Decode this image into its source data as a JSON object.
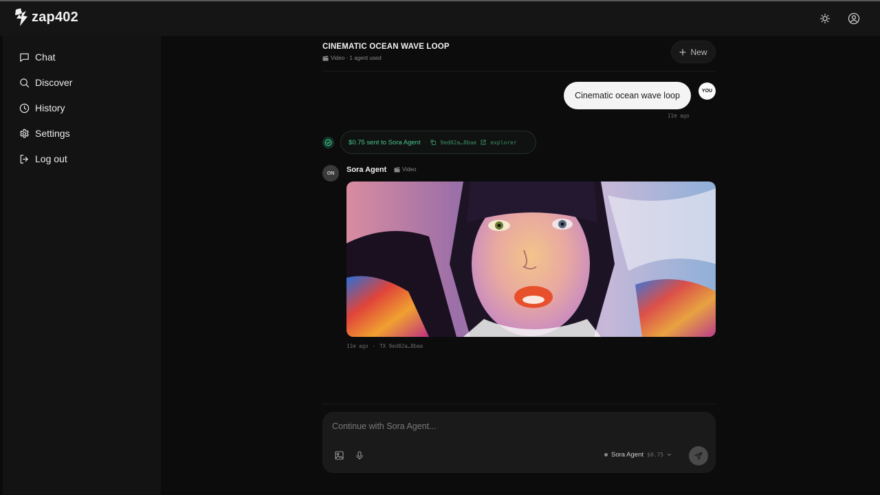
{
  "app": {
    "name": "zap402"
  },
  "colors": {
    "accent_green": "#4cc58c",
    "bubble_user": "#f4f4f4",
    "sidebar_bg": "#131313",
    "main_bg": "#0c0c0c"
  },
  "topbar": {
    "theme_icon": "sun-icon",
    "account_icon": "user-circle-icon"
  },
  "sidebar": {
    "items": [
      {
        "label": "Chat",
        "icon": "chat-icon"
      },
      {
        "label": "Discover",
        "icon": "search-icon"
      },
      {
        "label": "History",
        "icon": "clock-icon"
      },
      {
        "label": "Settings",
        "icon": "gear-icon"
      },
      {
        "label": "Log out",
        "icon": "logout-icon"
      }
    ]
  },
  "conversation": {
    "title": "CINEMATIC OCEAN WAVE LOOP",
    "meta": "Video · 1 agent used",
    "new_label": "New"
  },
  "user_message": {
    "avatar": "YOU",
    "text": "Cinematic ocean wave loop",
    "time": "11m ago"
  },
  "payment": {
    "text": "$0.75 sent to Sora Agent",
    "separator": "·",
    "tx": "9ed02a…8bae",
    "explorer": "explorer"
  },
  "agent_message": {
    "avatar": "ON",
    "name": "Sora Agent",
    "type": "Video",
    "time": "11m ago",
    "separator": "·",
    "tx_label": "TX 9ed02a…8bae"
  },
  "composer": {
    "placeholder": "Continue with Sora Agent...",
    "model_name": "Sora Agent",
    "model_price": "$0.75"
  }
}
